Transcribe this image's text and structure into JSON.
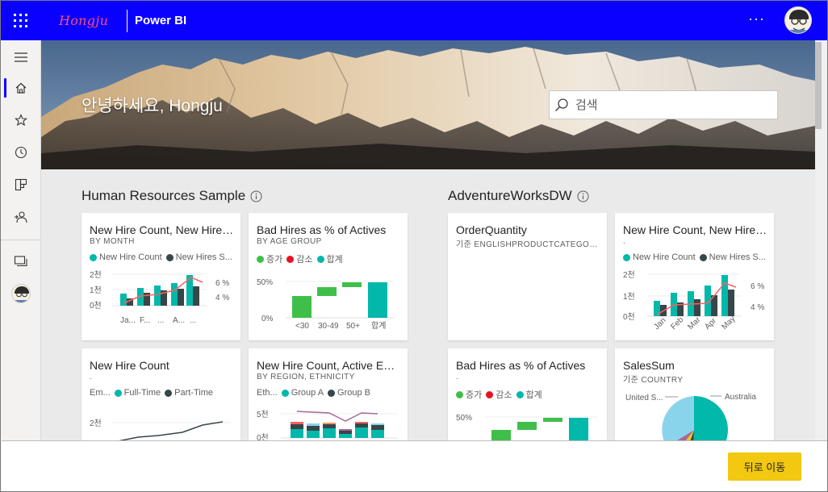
{
  "header": {
    "brand": "Hongju",
    "app_title": "Power BI",
    "more_label": "···"
  },
  "banner": {
    "greeting": "안녕하세요, Hongju",
    "search_placeholder": "검색"
  },
  "nav": {
    "items": [
      "menu-icon",
      "home-icon",
      "favorites-icon",
      "recent-icon",
      "apps-icon",
      "shared-icon",
      "workspaces-icon",
      "account-avatar"
    ],
    "active": "home"
  },
  "sections": [
    {
      "title": "Human Resources Sample"
    },
    {
      "title": "AdventureWorksDW"
    }
  ],
  "tiles": {
    "hr1": {
      "title": "New Hire Count, New Hires Same Period Last Year",
      "subtitle": "BY MONTH",
      "legend": [
        "New Hire Count",
        "New Hires S..."
      ],
      "y_ticks": [
        "2천",
        "1천",
        "0천"
      ],
      "y2_ticks": [
        "6 %",
        "4 %"
      ],
      "x_ticks": [
        "Ja...",
        "F...",
        "...",
        "A...",
        "..."
      ]
    },
    "hr2": {
      "title": "Bad Hires as % of Actives",
      "subtitle": "BY AGE GROUP",
      "legend": [
        "증가",
        "감소",
        "합계"
      ],
      "y_ticks": [
        "50%",
        "0%"
      ],
      "x_ticks": [
        "<30",
        "30-49",
        "50+",
        "합계"
      ]
    },
    "hr3": {
      "title": "New Hire Count",
      "subtitle": ".",
      "legend_prefix": "Em...",
      "legend": [
        "Full-Time",
        "Part-Time"
      ],
      "y_ticks": [
        "2천"
      ]
    },
    "hr4": {
      "title": "New Hire Count, Active Employee Count",
      "subtitle": "BY REGION, ETHNICITY",
      "legend_prefix": "Eth...",
      "legend": [
        "Group A",
        "Group B"
      ],
      "y_ticks": [
        "5천",
        "0천"
      ]
    },
    "aw1": {
      "title": "OrderQuantity",
      "subtitle": "기준 ENGLISHPRODUCTCATEGORYNAME"
    },
    "aw2": {
      "title": "New Hire Count, New Hires Same Period Last Year",
      "subtitle": ".",
      "legend": [
        "New Hire Count",
        "New Hires S..."
      ],
      "y_ticks": [
        "2천",
        "1천",
        "0천"
      ],
      "y2_ticks": [
        "6 %",
        "4 %"
      ],
      "x_ticks": [
        "Jan",
        "Feb",
        "Mar",
        "Apr",
        "May"
      ]
    },
    "aw3": {
      "title": "Bad Hires as % of Actives",
      "subtitle": ".",
      "legend": [
        "증가",
        "감소",
        "합계"
      ],
      "y_ticks": [
        "50%"
      ]
    },
    "aw4": {
      "title": "SalesSum",
      "subtitle": "기준 COUNTRY",
      "labels": [
        "United S...",
        "Australia"
      ]
    }
  },
  "colors": {
    "teal": "#01b8aa",
    "dark": "#374649",
    "red_line": "#fd625e",
    "green": "#3fbf4a",
    "red": "#e81123",
    "purple": "#a66999",
    "header": "#0a00ff",
    "button": "#f2c811"
  },
  "footer": {
    "back_label": "뒤로 이동"
  }
}
